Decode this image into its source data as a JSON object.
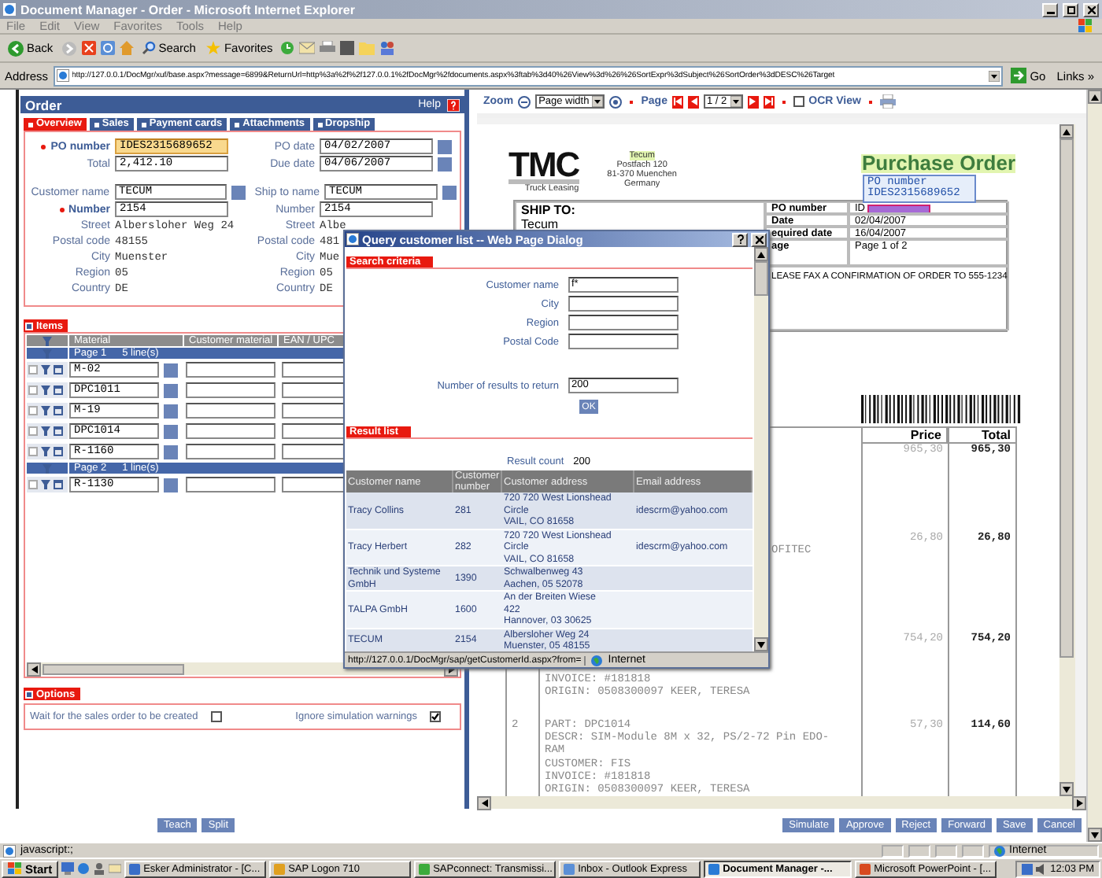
{
  "window": {
    "title": "Document Manager - Order - Microsoft Internet Explorer"
  },
  "menu": [
    "File",
    "Edit",
    "View",
    "Favorites",
    "Tools",
    "Help"
  ],
  "toolbar": {
    "back": "Back",
    "search": "Search",
    "favorites": "Favorites"
  },
  "address": {
    "label": "Address",
    "url": "http://127.0.0.1/DocMgr/xuf/base.aspx?message=6899&ReturnUrl=http%3a%2f%2f127.0.0.1%2fDocMgr%2fdocuments.aspx%3ftab%3d40%26View%3d%26%26SortExpr%3dSubject%26SortOrder%3dDESC%26Target",
    "go": "Go",
    "links": "Links »"
  },
  "order": {
    "title": "Order",
    "help": "Help",
    "tabs": [
      {
        "label": "Overview",
        "selected": true
      },
      {
        "label": "Sales",
        "selected": false
      },
      {
        "label": "Payment cards",
        "selected": false
      },
      {
        "label": "Attachments",
        "selected": false
      },
      {
        "label": "Dropship",
        "selected": false
      }
    ],
    "groups": [
      [
        {
          "left": {
            "label": "PO number",
            "value": "IDES2315689652",
            "kind": "input",
            "required": true,
            "highlighted": true
          },
          "right": {
            "label": "PO date",
            "value": "04/02/2007",
            "kind": "lookup",
            "required": false,
            "highlighted": false
          }
        },
        {
          "left": {
            "label": "Total",
            "value": "2,412.10",
            "kind": "input",
            "required": false,
            "highlighted": false
          },
          "right": {
            "label": "Due date",
            "value": "04/06/2007",
            "kind": "lookup",
            "required": false,
            "highlighted": false
          }
        }
      ],
      [
        {
          "left": {
            "label": "Customer name",
            "value": "TECUM",
            "kind": "lookup",
            "required": false,
            "highlighted": false
          },
          "right": {
            "label": "Ship to name",
            "value": "TECUM",
            "kind": "lookup",
            "required": false,
            "highlighted": false
          }
        },
        {
          "left": {
            "label": "Number",
            "value": "2154",
            "kind": "input",
            "required": true,
            "highlighted": false
          },
          "right": {
            "label": "Number",
            "value": "2154",
            "kind": "input",
            "required": false,
            "highlighted": false
          }
        },
        {
          "left": {
            "label": "Street",
            "value": "Albersloher Weg 24",
            "kind": "text",
            "required": false
          },
          "right": {
            "label": "Street",
            "value": "Albe",
            "kind": "text",
            "required": false
          }
        },
        {
          "left": {
            "label": "Postal code",
            "value": "48155",
            "kind": "text",
            "required": false
          },
          "right": {
            "label": "Postal code",
            "value": "481",
            "kind": "text",
            "required": false
          }
        },
        {
          "left": {
            "label": "City",
            "value": "Muenster",
            "kind": "text",
            "required": false
          },
          "right": {
            "label": "City",
            "value": "Mue",
            "kind": "text",
            "required": false
          }
        },
        {
          "left": {
            "label": "Region",
            "value": "05",
            "kind": "text",
            "required": false
          },
          "right": {
            "label": "Region",
            "value": "05",
            "kind": "text",
            "required": false
          }
        },
        {
          "left": {
            "label": "Country",
            "value": "DE",
            "kind": "text",
            "required": false
          },
          "right": {
            "label": "Country",
            "value": "DE",
            "kind": "text",
            "required": false
          }
        }
      ]
    ],
    "items": {
      "title": "Items",
      "columns": [
        "Material",
        "Customer material",
        "EAN / UPC"
      ],
      "pages": [
        {
          "label": "Page 1",
          "count": "5 line(s)",
          "rows": [
            {
              "material": "M-02",
              "checked": false
            },
            {
              "material": "DPC1011",
              "checked": false
            },
            {
              "material": "M-19",
              "checked": false
            },
            {
              "material": "DPC1014",
              "checked": false
            },
            {
              "material": "R-1160",
              "checked": false
            }
          ]
        },
        {
          "label": "Page 2",
          "count": "1 line(s)",
          "rows": [
            {
              "material": "R-1130",
              "checked": false
            }
          ]
        }
      ]
    },
    "options": {
      "title": "Options",
      "items": [
        {
          "label": "Wait for the sales order to be created",
          "checked": false
        },
        {
          "label": "Ignore simulation warnings",
          "checked": true
        }
      ]
    },
    "buttons": [
      "Teach",
      "Split"
    ]
  },
  "viewer": {
    "zoom": "Zoom",
    "zoom_mode": "Page width",
    "page": "Page",
    "page_select": "1 / 2",
    "ocr": {
      "label": "OCR View",
      "checked": false
    },
    "document": {
      "logo": "TMC",
      "tagline": "Truck Leasing",
      "sender": [
        "Tecum",
        "Postfach 120",
        "81-370 Muenchen",
        "Germany"
      ],
      "title": "Purchase Order",
      "tooltip": {
        "label": "PO number",
        "value": "IDES2315689652"
      },
      "ship_to": {
        "label": "SHIP TO:",
        "name": "Tecum"
      },
      "info": [
        {
          "label": "PO number",
          "value": "ID"
        },
        {
          "label": "Date",
          "value": "02/04/2007"
        },
        {
          "label": "equired date",
          "value": "16/04/2007"
        },
        {
          "label": "age",
          "value": "Page 1 of 2"
        }
      ],
      "note": "LEASE FAX A CONFIRMATION OF ORDER TO 555-1234",
      "columns": [
        "Price",
        "Total"
      ],
      "lines": [
        {
          "kind": "price",
          "price": "965,30",
          "total": "965,30"
        },
        {
          "kind": "fragment",
          "text": "OFITEC",
          "price": "26,80",
          "total": "26,80"
        },
        {
          "kind": "tail",
          "price": "754,20",
          "total": "754,20",
          "description": [
            "INVOICE: #181818",
            "ORIGIN: 0508300097 KEER, TERESA"
          ]
        },
        {
          "kind": "full",
          "number": "2",
          "price": "57,30",
          "total": "114,60",
          "description": [
            "PART: DPC1014",
            "DESCR: SIM-Module 8M x 32, PS/2-72 Pin EDO-",
            "RAM",
            "CUSTOMER: FIS",
            "INVOICE: #181818",
            "ORIGIN: 0508300097 KEER, TERESA"
          ]
        }
      ]
    },
    "buttons": [
      "Simulate",
      "Approve",
      "Reject",
      "Forward",
      "Save",
      "Cancel"
    ]
  },
  "dialog": {
    "title": "Query customer list -- Web Page Dialog",
    "search_title": "Search criteria",
    "fields": [
      {
        "label": "Customer name",
        "value": "f*"
      },
      {
        "label": "City"
      },
      {
        "label": "Region"
      },
      {
        "label": "Postal Code"
      }
    ],
    "results_field": {
      "label": "Number of results to return",
      "value": "200"
    },
    "ok": "OK",
    "result_title": "Result list",
    "count_label": "Result count",
    "count": "200",
    "columns": [
      "Customer name",
      "Customer number",
      "Customer address",
      "Email address"
    ],
    "rows": [
      {
        "name": "Tracy Collins",
        "number": "281",
        "address": [
          "720 720 West Lionshead",
          "Circle",
          "VAIL, CO 81658"
        ],
        "email": "idescrm@yahoo.com"
      },
      {
        "name": "Tracy Herbert",
        "number": "282",
        "address": [
          "720 720 West Lionshead",
          "Circle",
          "VAIL, CO 81658"
        ],
        "email": "idescrm@yahoo.com"
      },
      {
        "name": "Technik und Systeme GmbH",
        "number": "1390",
        "address": [
          "Schwalbenweg 43",
          "Aachen, 05 52078"
        ]
      },
      {
        "name": "TALPA GmbH",
        "number": "1600",
        "address": [
          "An der Breiten Wiese",
          "422",
          "Hannover, 03 30625"
        ]
      },
      {
        "name": "TECUM",
        "number": "2154",
        "address": [
          "Albersloher Weg 24",
          "Muenster, 05 48155"
        ]
      }
    ],
    "status_url": "http://127.0.0.1/DocMgr/sap/getCustomerId.aspx?from=",
    "zone": "Internet"
  },
  "status_bar": {
    "text": "javascript:;",
    "zone": "Internet"
  },
  "taskbar": {
    "start": "Start",
    "tasks": [
      {
        "label": "Esker Administrator - [C...",
        "selected": false
      },
      {
        "label": "SAP Logon 710",
        "selected": false
      },
      {
        "label": "SAPconnect: Transmissi...",
        "selected": false
      },
      {
        "label": "Inbox - Outlook Express",
        "selected": false
      },
      {
        "label": "Document Manager -...",
        "selected": true
      },
      {
        "label": "Microsoft PowerPoint - [...",
        "selected": false
      }
    ],
    "clock": "12:03 PM"
  }
}
